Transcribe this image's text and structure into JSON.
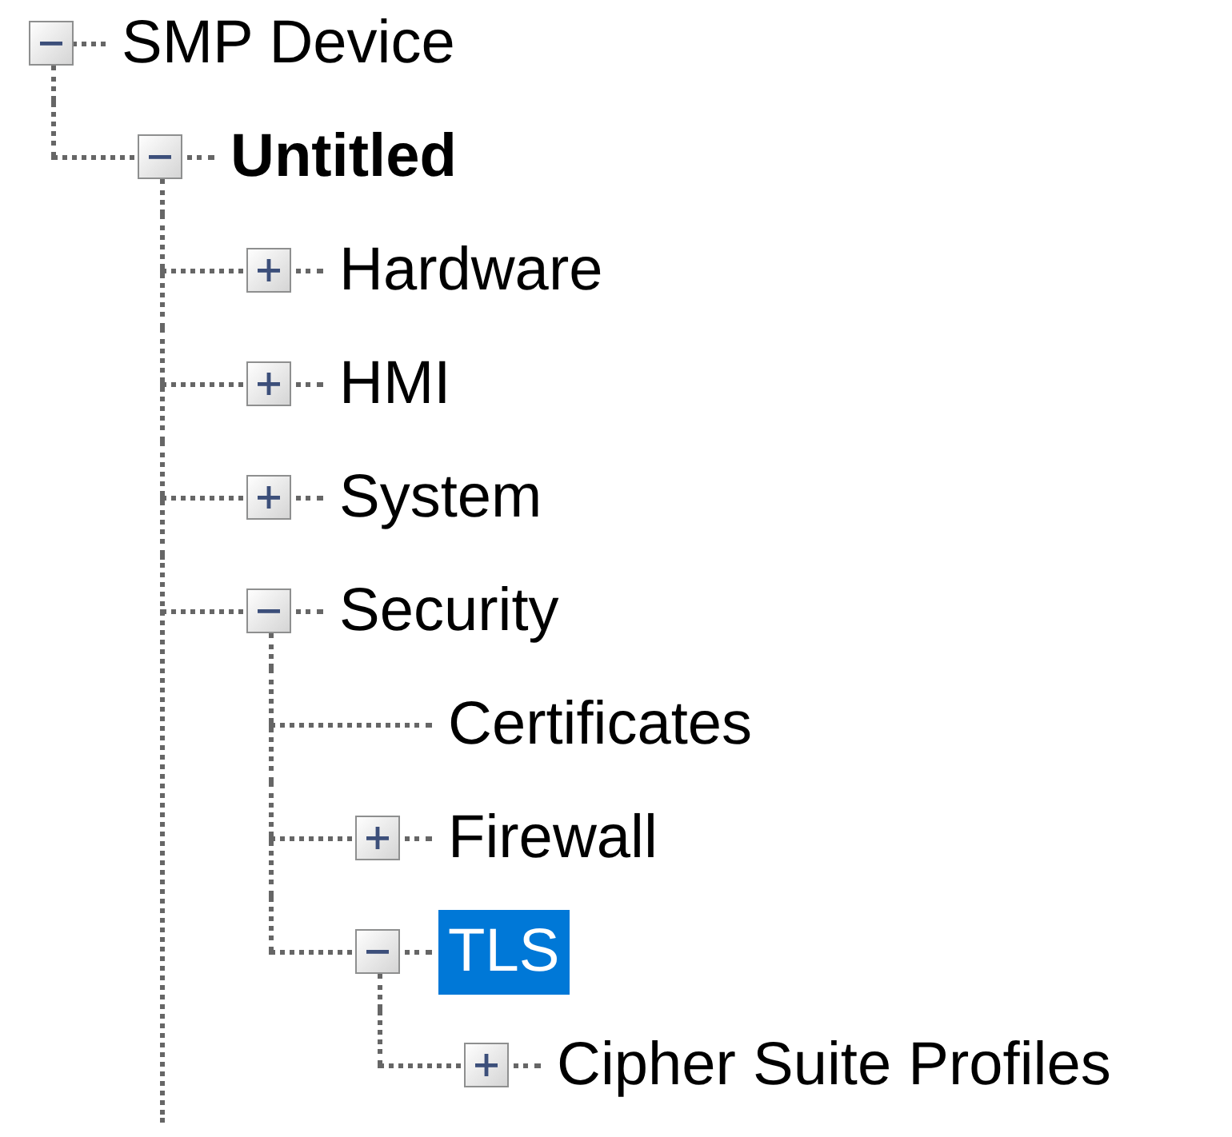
{
  "tree": [
    {
      "label": "SMP Device",
      "expanded": true,
      "selected": false,
      "active": false,
      "children": [
        {
          "label": "Untitled",
          "expanded": true,
          "selected": false,
          "active": true,
          "continues": true,
          "children": [
            {
              "label": "Hardware",
              "expanded": false,
              "selected": false,
              "active": false
            },
            {
              "label": "HMI",
              "expanded": false,
              "selected": false,
              "active": false
            },
            {
              "label": "System",
              "expanded": false,
              "selected": false,
              "active": false
            },
            {
              "label": "Security",
              "expanded": true,
              "selected": false,
              "active": false,
              "children": [
                {
                  "label": "Certificates",
                  "selected": false,
                  "active": false
                },
                {
                  "label": "Firewall",
                  "expanded": false,
                  "selected": false,
                  "active": false
                },
                {
                  "label": "TLS",
                  "expanded": true,
                  "selected": true,
                  "active": false,
                  "children": [
                    {
                      "label": "Cipher Suite Profiles",
                      "expanded": false,
                      "selected": false,
                      "active": false
                    }
                  ]
                }
              ]
            }
          ]
        }
      ]
    }
  ]
}
